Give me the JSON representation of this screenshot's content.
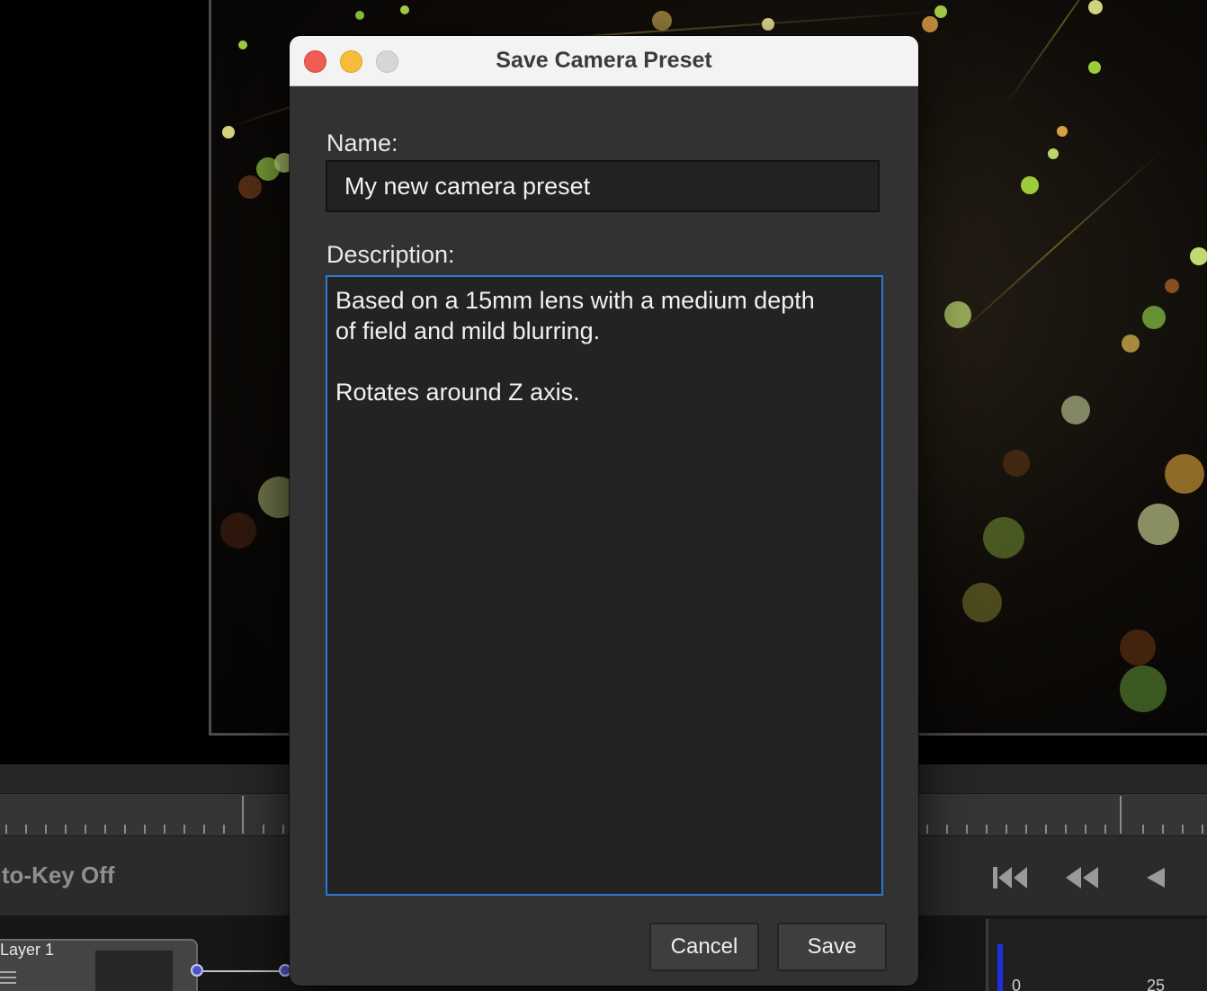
{
  "dialog": {
    "title": "Save Camera Preset",
    "name_label": "Name:",
    "name_value": "My new camera preset",
    "description_label": "Description:",
    "description_value": "Based on a 15mm lens with a medium depth\nof field and mild blurring.\n\nRotates around Z axis.",
    "cancel_label": "Cancel",
    "save_label": "Save",
    "window_controls": [
      "close",
      "minimize",
      "zoom"
    ]
  },
  "background": {
    "autokey_label": "uto-Key Off",
    "layer_label": "Layer 1",
    "timeline_numbers": [
      "0",
      "25"
    ],
    "transport_icons": [
      "skip-to-start-icon",
      "rewind-icon",
      "play-reverse-icon"
    ]
  },
  "colors": {
    "accent_focus": "#2c7ad6",
    "dialog_bg": "#323232",
    "close": "#ee5c54",
    "minimize": "#f7bc3b",
    "timeline_marker": "#1e2fe0"
  }
}
